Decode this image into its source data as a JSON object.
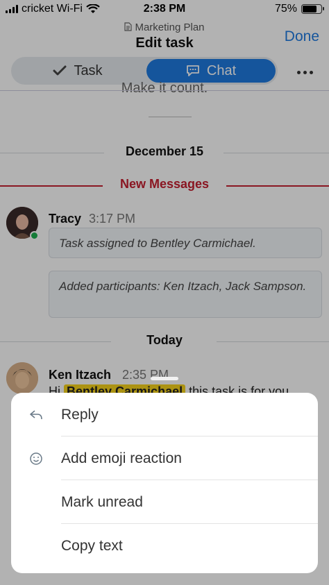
{
  "status_bar": {
    "carrier": "cricket Wi-Fi",
    "time": "2:38 PM",
    "battery": "75%"
  },
  "header": {
    "breadcrumb": "Marketing Plan",
    "title": "Edit task",
    "done_label": "Done"
  },
  "tabs": [
    {
      "label": "Task",
      "icon": "checkmark-icon"
    },
    {
      "label": "Chat",
      "icon": "chat-bubble-icon",
      "selected": true
    }
  ],
  "chat": {
    "previous_message_fragment": "Make it count.",
    "date_separator": "December 15",
    "new_messages_label": "New Messages",
    "messages": [
      {
        "sender": "Tracy",
        "time": "3:17 PM",
        "system_notes": [
          "Task assigned to Bentley Carmichael.",
          "Added participants: Ken Itzach, Jack Sampson."
        ]
      }
    ],
    "today_separator": "Today",
    "latest_message": {
      "sender": "Ken Itzach",
      "time": "2:35 PM",
      "prefix": "Hi",
      "mention": "Bentley Carmichael",
      "suffix": "this task is for you",
      "trailing_fragment": ","
    }
  },
  "action_sheet": {
    "items": [
      {
        "label": "Reply",
        "icon": "reply-icon"
      },
      {
        "label": "Add emoji reaction",
        "icon": "emoji-add-icon"
      },
      {
        "label": "Mark unread",
        "icon": ""
      },
      {
        "label": "Copy text",
        "icon": ""
      }
    ]
  },
  "colors": {
    "accent_blue": "#1f7ae0",
    "new_messages_red": "#c62032",
    "mention_yellow": "#f6d31a",
    "online_green": "#1eb04f"
  }
}
